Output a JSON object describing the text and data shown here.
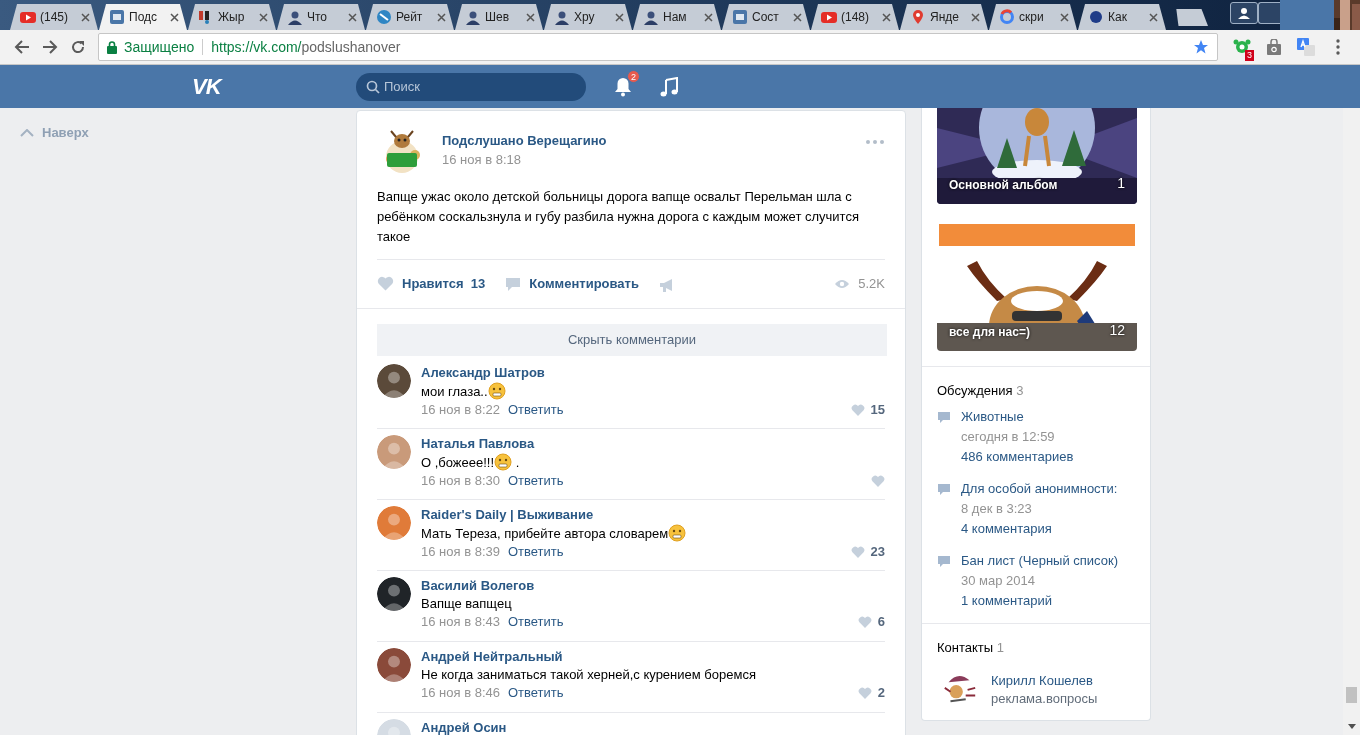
{
  "browser": {
    "tabs": [
      {
        "title": "(145)",
        "selected": false
      },
      {
        "title": "Подс",
        "selected": true
      },
      {
        "title": "Жыр",
        "selected": false
      },
      {
        "title": "Что",
        "selected": false
      },
      {
        "title": "Рейт",
        "selected": false
      },
      {
        "title": "Шев",
        "selected": false
      },
      {
        "title": "Хру",
        "selected": false
      },
      {
        "title": "Нам",
        "selected": false
      },
      {
        "title": "Сост",
        "selected": false
      },
      {
        "title": "(148)",
        "selected": false
      },
      {
        "title": "Янде",
        "selected": false
      },
      {
        "title": "скри",
        "selected": false
      },
      {
        "title": "Как",
        "selected": false
      }
    ],
    "address": {
      "secure_label": "Защищено",
      "url_host": "https://vk.com/",
      "url_path": "podslushanover"
    },
    "extension_badge": "3"
  },
  "header": {
    "logo": "VK",
    "search": {
      "placeholder": "Поиск"
    },
    "notifications_badge": "2"
  },
  "left_nav": {
    "back_to_top": "Наверх"
  },
  "post": {
    "author": "Подслушано Верещагино",
    "date": "16 ноя в 8:18",
    "text": "Вапще ужас около детской больницы дорога вапще освальт Перельман шла с ребёнком соскальзнула и губу разбила нужна дорога с каждым может случится такое",
    "likes_label": "Нравится",
    "likes_count": "13",
    "comment_label": "Комментировать",
    "views": "5.2K",
    "hide_comments": "Скрыть комментарии"
  },
  "comments": [
    {
      "author": "Александр Шатров",
      "text": "мои глаза..",
      "emoji": true,
      "date": "16 ноя в 8:22",
      "reply": "Ответить",
      "likes": "15"
    },
    {
      "author": "Наталья Павлова",
      "text": "О ,божеее!!!",
      "emoji": true,
      "text_after": ".",
      "date": "16 ноя в 8:30",
      "reply": "Ответить"
    },
    {
      "author": "Raider's Daily | Выживание",
      "text": "Мать Тереза, прибейте автора словарем",
      "emoji": true,
      "date": "16 ноя в 8:39",
      "reply": "Ответить",
      "likes": "23"
    },
    {
      "author": "Василий Волегов",
      "text": "Вапще вапщец",
      "emoji": false,
      "date": "16 ноя в 8:43",
      "reply": "Ответить",
      "likes": "6"
    },
    {
      "author": "Андрей Нейтральный",
      "text": "Не когда заниматься такой херней,с курением боремся",
      "emoji": false,
      "date": "16 ноя в 8:46",
      "reply": "Ответить",
      "likes": "2"
    },
    {
      "author": "Андрей Осин"
    }
  ],
  "sidebar": {
    "albums": [
      {
        "title": "Основной альбом",
        "count": "1",
        "kind": "picture"
      },
      {
        "title": "все для нас=)",
        "count": "12",
        "kind": "picture"
      }
    ],
    "discussions": {
      "title": "Обсуждения",
      "count": "3",
      "topics": [
        {
          "title": "Животные",
          "date": "сегодня в 12:59",
          "comments": "486 комментариев"
        },
        {
          "title": "Для особой анонимности:",
          "date": "8 дек в 3:23",
          "comments": "4 комментария"
        },
        {
          "title": "Бан лист (Черный список)",
          "date": "30 мар 2014",
          "comments": "1 комментарий"
        }
      ]
    },
    "contacts": {
      "title": "Контакты",
      "count": "1",
      "items": [
        {
          "name": "Кирилл Кошелев",
          "role": "реклама.вопросы"
        }
      ]
    }
  }
}
